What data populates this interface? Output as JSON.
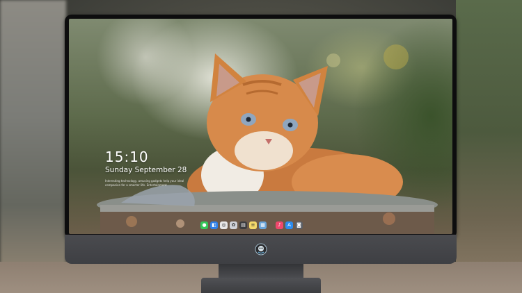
{
  "lockscreen": {
    "time": "15:10",
    "date": "Sunday September 28",
    "tagline": "Interesting technology, amusing gadgets help your ideal companion for a smarter life. Entertainment"
  },
  "dock": {
    "apps": [
      {
        "name": "messages-icon",
        "color": "#34c759",
        "glyph": "●"
      },
      {
        "name": "finder-icon",
        "color": "#2f7fe6",
        "glyph": "◧"
      },
      {
        "name": "safari-icon",
        "color": "#e8e8e8",
        "glyph": "◎"
      },
      {
        "name": "photos-icon",
        "color": "#d0d3da",
        "glyph": "✿"
      },
      {
        "name": "clapper-icon",
        "color": "#3c3c3f",
        "glyph": "▤"
      },
      {
        "name": "notes-icon",
        "color": "#f3d86a",
        "glyph": "≡"
      },
      {
        "name": "preview-icon",
        "color": "#6aa4d9",
        "glyph": "▦"
      },
      {
        "name": "music-icon",
        "color": "#f0476c",
        "glyph": "♪"
      },
      {
        "name": "app-store-icon",
        "color": "#2b8cf0",
        "glyph": "A"
      },
      {
        "name": "camera-icon",
        "color": "#5b5f66",
        "glyph": "◙"
      }
    ]
  },
  "colors": {
    "monitor_bezel": "#0d0d0e",
    "monitor_chin": "#45464a",
    "kitten_orange": "#d9894a"
  }
}
